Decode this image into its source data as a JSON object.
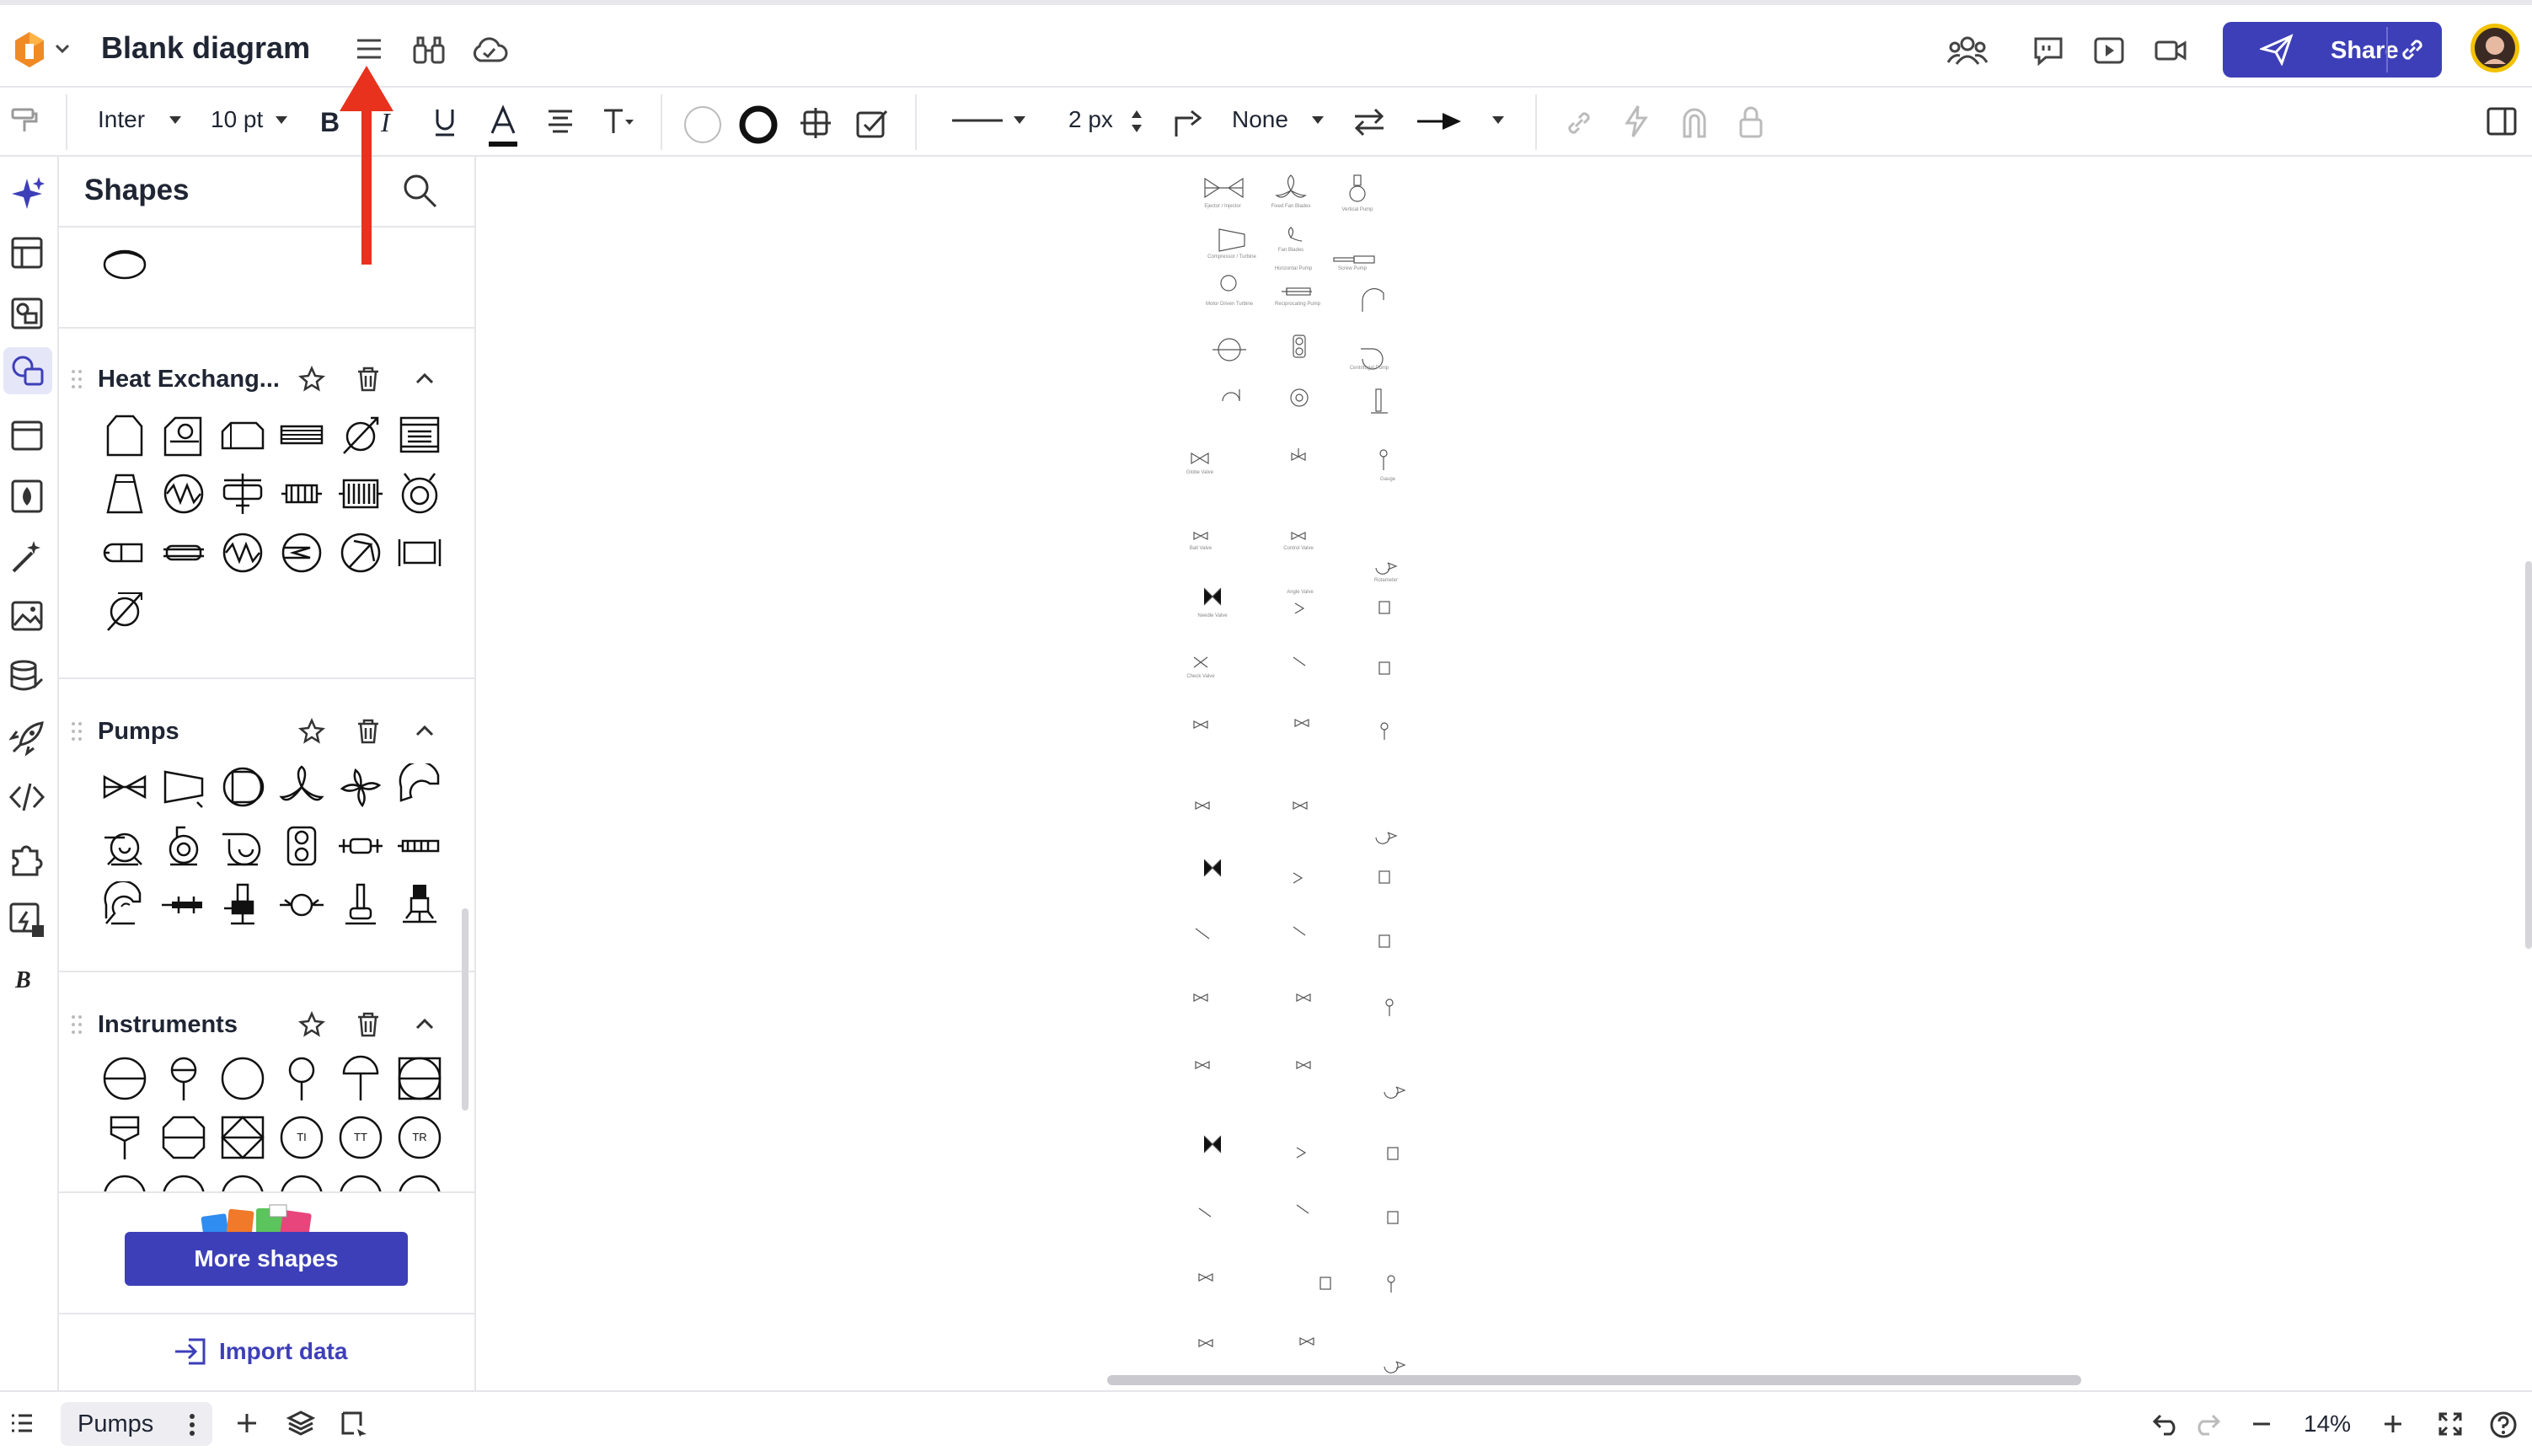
{
  "header": {
    "title": "Blank diagram",
    "share_label": "Share"
  },
  "toolbar": {
    "font": "Inter",
    "font_size": "10 pt",
    "line_width": "2 px",
    "arrow_start": "None"
  },
  "panel": {
    "title": "Shapes",
    "sections": [
      {
        "label": "Heat Exchang..."
      },
      {
        "label": "Pumps"
      },
      {
        "label": "Instruments"
      }
    ],
    "instrument_labels": [
      "TI",
      "TT",
      "TR"
    ],
    "more_shapes_label": "More shapes",
    "import_data_label": "Import data"
  },
  "bottom": {
    "page_tab": "Pumps",
    "zoom": "14%"
  },
  "canvas": {
    "labels": [
      "Ejector / Injector",
      "Fixed Fan Blades",
      "Vertical Pump",
      "Compressor / Turbine",
      "Fan Blades",
      "Horizontal Pump",
      "Screw Pump",
      "Motor Driven Turbine",
      "Reciprocating Pump",
      "Centrifugal Pump",
      "Globe Valve",
      "Ball Valve",
      "Control Valve",
      "Gauge",
      "Needle Valve",
      "Angle Valve",
      "Check Valve",
      "Rotameter"
    ]
  },
  "colors": {
    "accent": "#3d3fb8",
    "annotation": "#e8321e",
    "logo": "#f08a24"
  }
}
